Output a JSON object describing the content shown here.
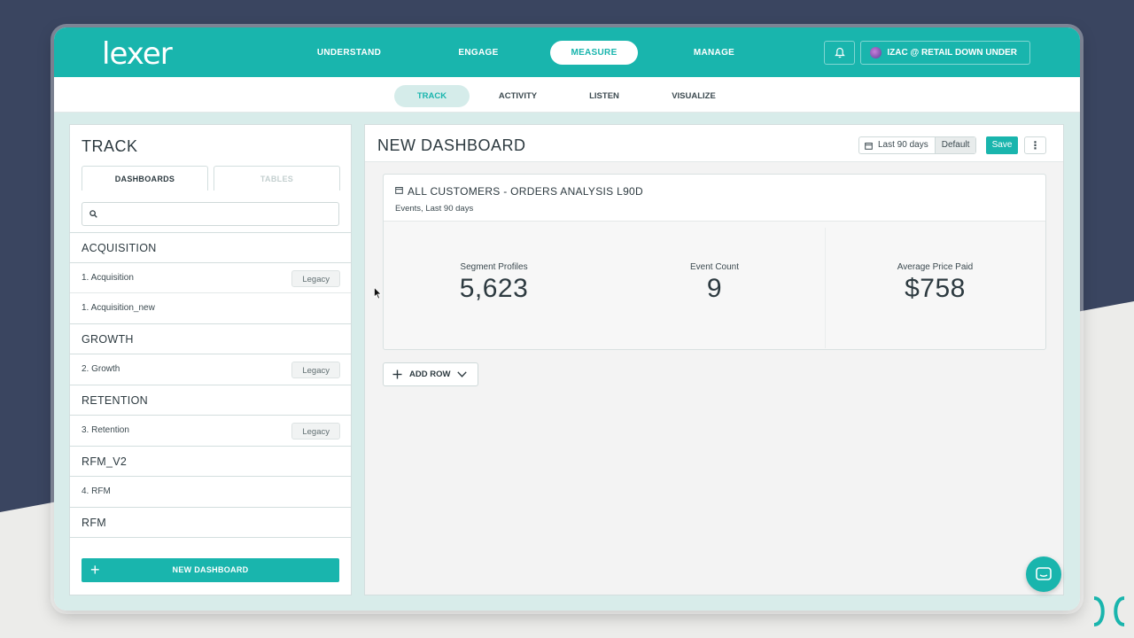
{
  "brand": {
    "logo_text": "lexer",
    "accent_color": "#19b5ad"
  },
  "mainnav": {
    "items": [
      {
        "label": "UNDERSTAND",
        "active": false
      },
      {
        "label": "ENGAGE",
        "active": false
      },
      {
        "label": "MEASURE",
        "active": true
      },
      {
        "label": "MANAGE",
        "active": false
      }
    ]
  },
  "topbar": {
    "notification_icon": "bell-icon",
    "account_label": "IZAC @ RETAIL DOWN UNDER"
  },
  "subnav": {
    "items": [
      {
        "label": "TRACK",
        "active": true
      },
      {
        "label": "ACTIVITY",
        "active": false
      },
      {
        "label": "LISTEN",
        "active": false
      },
      {
        "label": "VISUALIZE",
        "active": false
      }
    ]
  },
  "leftpanel": {
    "title": "TRACK",
    "tabs": [
      {
        "label": "DASHBOARDS",
        "active": true
      },
      {
        "label": "TABLES",
        "active": false
      }
    ],
    "search": {
      "value": "",
      "placeholder": ""
    },
    "groups": [
      {
        "header": "ACQUISITION",
        "items": [
          {
            "label": "1. Acquisition",
            "badge": "Legacy"
          },
          {
            "label": "1. Acquisition_new",
            "badge": ""
          }
        ]
      },
      {
        "header": "GROWTH",
        "items": [
          {
            "label": "2. Growth",
            "badge": "Legacy"
          }
        ]
      },
      {
        "header": "RETENTION",
        "items": [
          {
            "label": "3. Retention",
            "badge": "Legacy"
          }
        ]
      },
      {
        "header": "RFM_V2",
        "items": [
          {
            "label": "4. RFM",
            "badge": ""
          }
        ]
      },
      {
        "header": "RFM",
        "items": []
      }
    ],
    "new_dashboard_label": "NEW DASHBOARD"
  },
  "dashboard": {
    "title": "NEW DASHBOARD",
    "date_range": "Last 90 days",
    "date_default": "Default",
    "save_label": "Save",
    "more_icon": "more-vertical-icon",
    "widget": {
      "title": "ALL CUSTOMERS - ORDERS ANALYSIS L90D",
      "subtitle": "Events, Last 90 days",
      "metrics": [
        {
          "label": "Segment Profiles",
          "value": "5,623"
        },
        {
          "label": "Event Count",
          "value": "9"
        },
        {
          "label": "Average Price Paid",
          "value": "$758"
        }
      ]
    },
    "add_row_label": "ADD ROW"
  }
}
